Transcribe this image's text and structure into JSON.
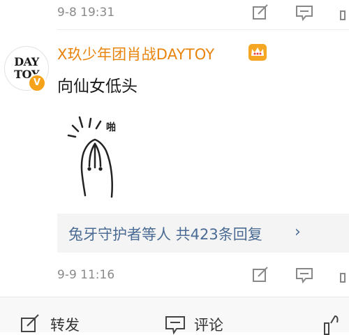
{
  "top_comment": {
    "timestamp": "9-8 19:31",
    "actions": [
      "share-icon",
      "comment-icon"
    ]
  },
  "comment": {
    "avatar_text_line1": "DAY",
    "avatar_text_line2": "TOY",
    "verified_badge": "V",
    "username": "X玖少年团肖战DAYTOY",
    "text": "向仙女低头",
    "sticker_text": "啪",
    "reply_summary": "兔牙守护者等人  共423条回复",
    "reply_chevron": "›",
    "timestamp": "9-9 11:16"
  },
  "bottom_bar": {
    "repost_label": "转发",
    "comment_label": "评论"
  },
  "colors": {
    "username": "#e8830c",
    "reply_link": "#4a6b94",
    "meta_gray": "#8a8a8a",
    "badge": "#f7a21b"
  }
}
